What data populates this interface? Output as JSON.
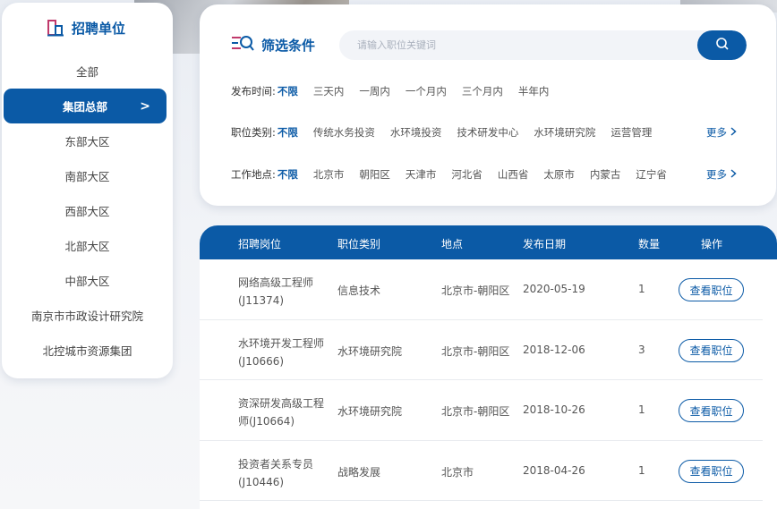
{
  "colors": {
    "primary": "#0b5aa6",
    "bg": "#eef1f5"
  },
  "sidebar": {
    "title": "招聘单位",
    "title_icon": "building-icon",
    "items": [
      {
        "label": "全部",
        "active": false
      },
      {
        "label": "集团总部",
        "active": true
      },
      {
        "label": "东部大区",
        "active": false
      },
      {
        "label": "南部大区",
        "active": false
      },
      {
        "label": "西部大区",
        "active": false
      },
      {
        "label": "北部大区",
        "active": false
      },
      {
        "label": "中部大区",
        "active": false
      },
      {
        "label": "南京市市政设计研究院",
        "active": false
      },
      {
        "label": "北控城市资源集团",
        "active": false
      }
    ],
    "active_chevron": ">"
  },
  "filter": {
    "title": "筛选条件",
    "title_icon": "filter-search-icon",
    "search": {
      "placeholder": "请输入职位关键词",
      "value": "",
      "button_icon": "search-icon"
    },
    "rows": [
      {
        "label": "发布时间:",
        "options": [
          "不限",
          "三天内",
          "一周内",
          "一个月内",
          "三个月内",
          "半年内"
        ],
        "selected": 0,
        "more": ""
      },
      {
        "label": "职位类别:",
        "options": [
          "不限",
          "传统水务投资",
          "水环境投资",
          "技术研发中心",
          "水环境研究院",
          "运营管理"
        ],
        "selected": 0,
        "more": "更多"
      },
      {
        "label": "工作地点:",
        "options": [
          "不限",
          "北京市",
          "朝阳区",
          "天津市",
          "河北省",
          "山西省",
          "太原市",
          "内蒙古",
          "辽宁省"
        ],
        "selected": 0,
        "more": "更多"
      }
    ]
  },
  "table": {
    "headers": [
      "招聘岗位",
      "职位类别",
      "地点",
      "发布日期",
      "数量",
      "操作"
    ],
    "rows": [
      {
        "position": "网络高级工程师(J11374)",
        "category": "信息技术",
        "location": "北京市-朝阳区",
        "date": "2020-05-19",
        "count": "1",
        "action": "查看职位"
      },
      {
        "position": "水环境开发工程师(J10666)",
        "category": "水环境研究院",
        "location": "北京市-朝阳区",
        "date": "2018-12-06",
        "count": "3",
        "action": "查看职位"
      },
      {
        "position": "资深研发高级工程师(J10664)",
        "category": "水环境研究院",
        "location": "北京市-朝阳区",
        "date": "2018-10-26",
        "count": "1",
        "action": "查看职位"
      },
      {
        "position": "投资者关系专员(J10446)",
        "category": "战略发展",
        "location": "北京市",
        "date": "2018-04-26",
        "count": "1",
        "action": "查看职位"
      }
    ]
  }
}
